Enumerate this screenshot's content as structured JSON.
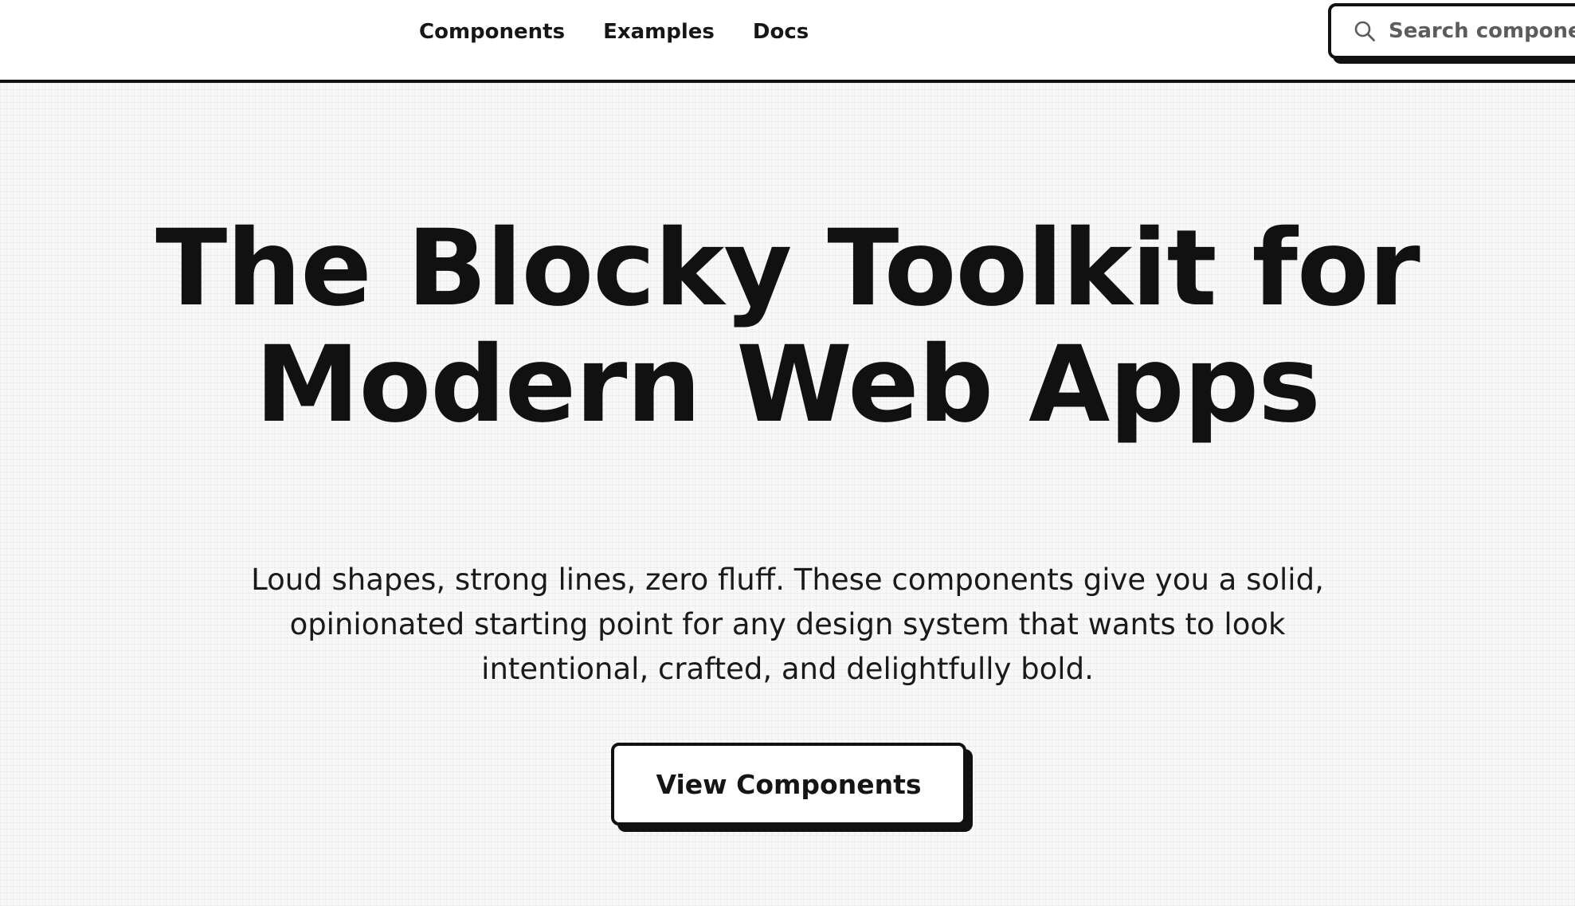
{
  "header": {
    "nav": [
      {
        "label": "Components"
      },
      {
        "label": "Examples"
      },
      {
        "label": "Docs"
      }
    ],
    "search": {
      "placeholder": "Search components...",
      "icon": "search-icon"
    }
  },
  "hero": {
    "title_line1": "The Blocky Toolkit for",
    "title_line2": "Modern Web Apps",
    "subtitle_line1": "Loud shapes, strong lines, zero fluff. These components give you a solid,",
    "subtitle_line2": "opinionated starting point for any design system that wants to look",
    "subtitle_line3": "intentional, crafted, and delightfully bold.",
    "cta_label": "View Components"
  },
  "colors": {
    "ink": "#111111",
    "background": "#f8f8f8",
    "surface": "#ffffff"
  }
}
